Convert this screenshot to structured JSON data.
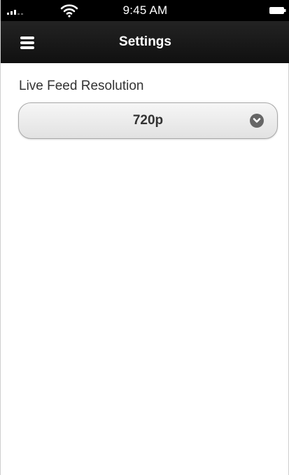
{
  "status_bar": {
    "time": "9:45 AM"
  },
  "nav": {
    "title": "Settings",
    "menu_icon": "hamburger-menu-icon"
  },
  "settings": {
    "field_label": "Live Feed Resolution",
    "resolution_value": "720p",
    "dropdown_icon": "chevron-down-icon"
  },
  "colors": {
    "status_bar_bg": "#000000",
    "nav_bg": "#1a1a1a",
    "select_bg": "#ebebeb",
    "text": "#333333"
  }
}
